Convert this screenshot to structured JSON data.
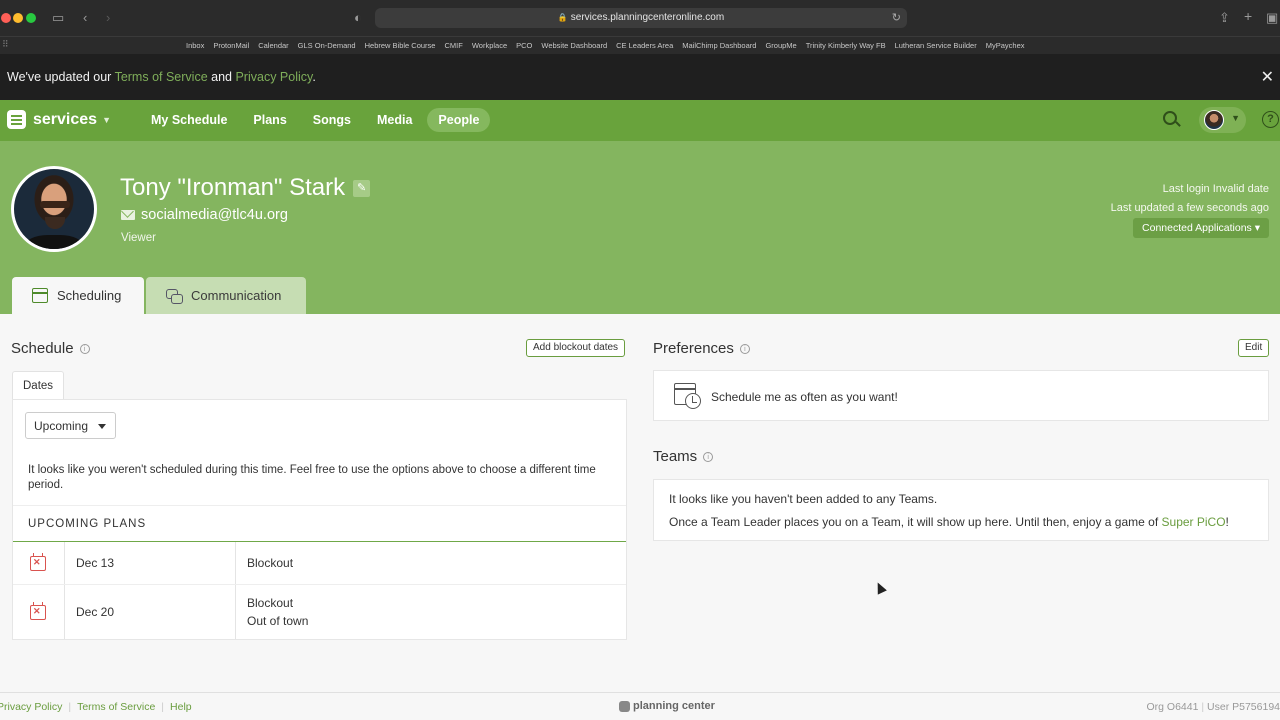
{
  "browser": {
    "url": "services.planningcenteronline.com",
    "bookmarks": [
      "Inbox",
      "ProtonMail",
      "Calendar",
      "GLS On-Demand",
      "Hebrew Bible Course",
      "CMIF",
      "Workplace",
      "PCO",
      "Website Dashboard",
      "CE Leaders Area",
      "MailChimp Dashboard",
      "GroupMe",
      "Trinity Kimberly Way  FB",
      "Lutheran Service Builder",
      "MyPaychex"
    ]
  },
  "notice": {
    "prefix": "We've updated our ",
    "terms": "Terms of Service",
    "middle": " and ",
    "privacy": "Privacy Policy",
    "suffix": "."
  },
  "nav": {
    "brand": "services",
    "links": [
      "My Schedule",
      "Plans",
      "Songs",
      "Media",
      "People"
    ],
    "active": "People"
  },
  "profile": {
    "name": "Tony \"Ironman\" Stark",
    "email": "socialmedia@tlc4u.org",
    "role": "Viewer",
    "last_login": "Last login Invalid date",
    "last_updated": "Last updated a few seconds ago",
    "connected_apps": "Connected Applications",
    "tabs": [
      "Scheduling",
      "Communication"
    ]
  },
  "schedule": {
    "title": "Schedule",
    "add_blockout": "Add blockout dates",
    "dates_tab": "Dates",
    "filter": "Upcoming",
    "empty_message": "It looks like you weren't scheduled during this time. Feel free to use the options above to choose a different time period.",
    "upcoming_heading": "UPCOMING PLANS",
    "plans": [
      {
        "date": "Dec 13",
        "lines": [
          "Blockout"
        ]
      },
      {
        "date": "Dec 20",
        "lines": [
          "Blockout",
          "Out of town"
        ]
      }
    ]
  },
  "preferences": {
    "title": "Preferences",
    "edit": "Edit",
    "text": "Schedule me as often as you want!"
  },
  "teams": {
    "title": "Teams",
    "line1": "It looks like you haven't been added to any Teams.",
    "line2_prefix": "Once a Team Leader places you on a Team, it will show up here. Until then, enjoy a game of ",
    "line2_link": "Super PiCO",
    "line2_suffix": "!"
  },
  "footer": {
    "links": [
      "Privacy Policy",
      "Terms of Service",
      "Help"
    ],
    "brand": "planning center",
    "org": "Org O6441",
    "user": "User P5756194"
  }
}
